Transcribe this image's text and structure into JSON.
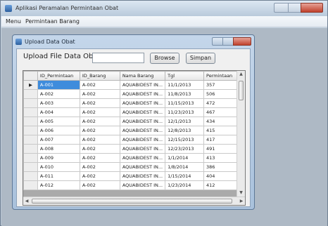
{
  "app": {
    "title": "Aplikasi Peramalan Permintaan Obat"
  },
  "menu": {
    "items": [
      "Menu",
      "Permintaan Barang"
    ]
  },
  "child": {
    "title": "Upload Data Obat"
  },
  "form": {
    "label": "Upload File Data Obat :",
    "file_value": "",
    "browse_label": "Browse",
    "simpan_label": "Simpan"
  },
  "grid": {
    "columns": [
      "ID_Permintaan",
      "ID_Barang",
      "Nama Barang",
      "Tgl",
      "Permintaan"
    ],
    "current_row_marker": "▶",
    "rows": [
      [
        "A-001",
        "A-002",
        "AQUABIDEST IN...",
        "11/1/2013",
        "357"
      ],
      [
        "A-002",
        "A-002",
        "AQUABIDEST IN...",
        "11/8/2013",
        "506"
      ],
      [
        "A-003",
        "A-002",
        "AQUABIDEST IN...",
        "11/15/2013",
        "472"
      ],
      [
        "A-004",
        "A-002",
        "AQUABIDEST IN...",
        "11/23/2013",
        "467"
      ],
      [
        "A-005",
        "A-002",
        "AQUABIDEST IN...",
        "12/1/2013",
        "434"
      ],
      [
        "A-006",
        "A-002",
        "AQUABIDEST IN...",
        "12/8/2013",
        "415"
      ],
      [
        "A-007",
        "A-002",
        "AQUABIDEST IN...",
        "12/15/2013",
        "417"
      ],
      [
        "A-008",
        "A-002",
        "AQUABIDEST IN...",
        "12/23/2013",
        "491"
      ],
      [
        "A-009",
        "A-002",
        "AQUABIDEST IN...",
        "1/1/2014",
        "413"
      ],
      [
        "A-010",
        "A-002",
        "AQUABIDEST IN...",
        "1/8/2014",
        "386"
      ],
      [
        "A-011",
        "A-002",
        "AQUABIDEST IN...",
        "1/15/2014",
        "404"
      ],
      [
        "A-012",
        "A-002",
        "AQUABIDEST IN...",
        "1/23/2014",
        "412"
      ]
    ]
  }
}
